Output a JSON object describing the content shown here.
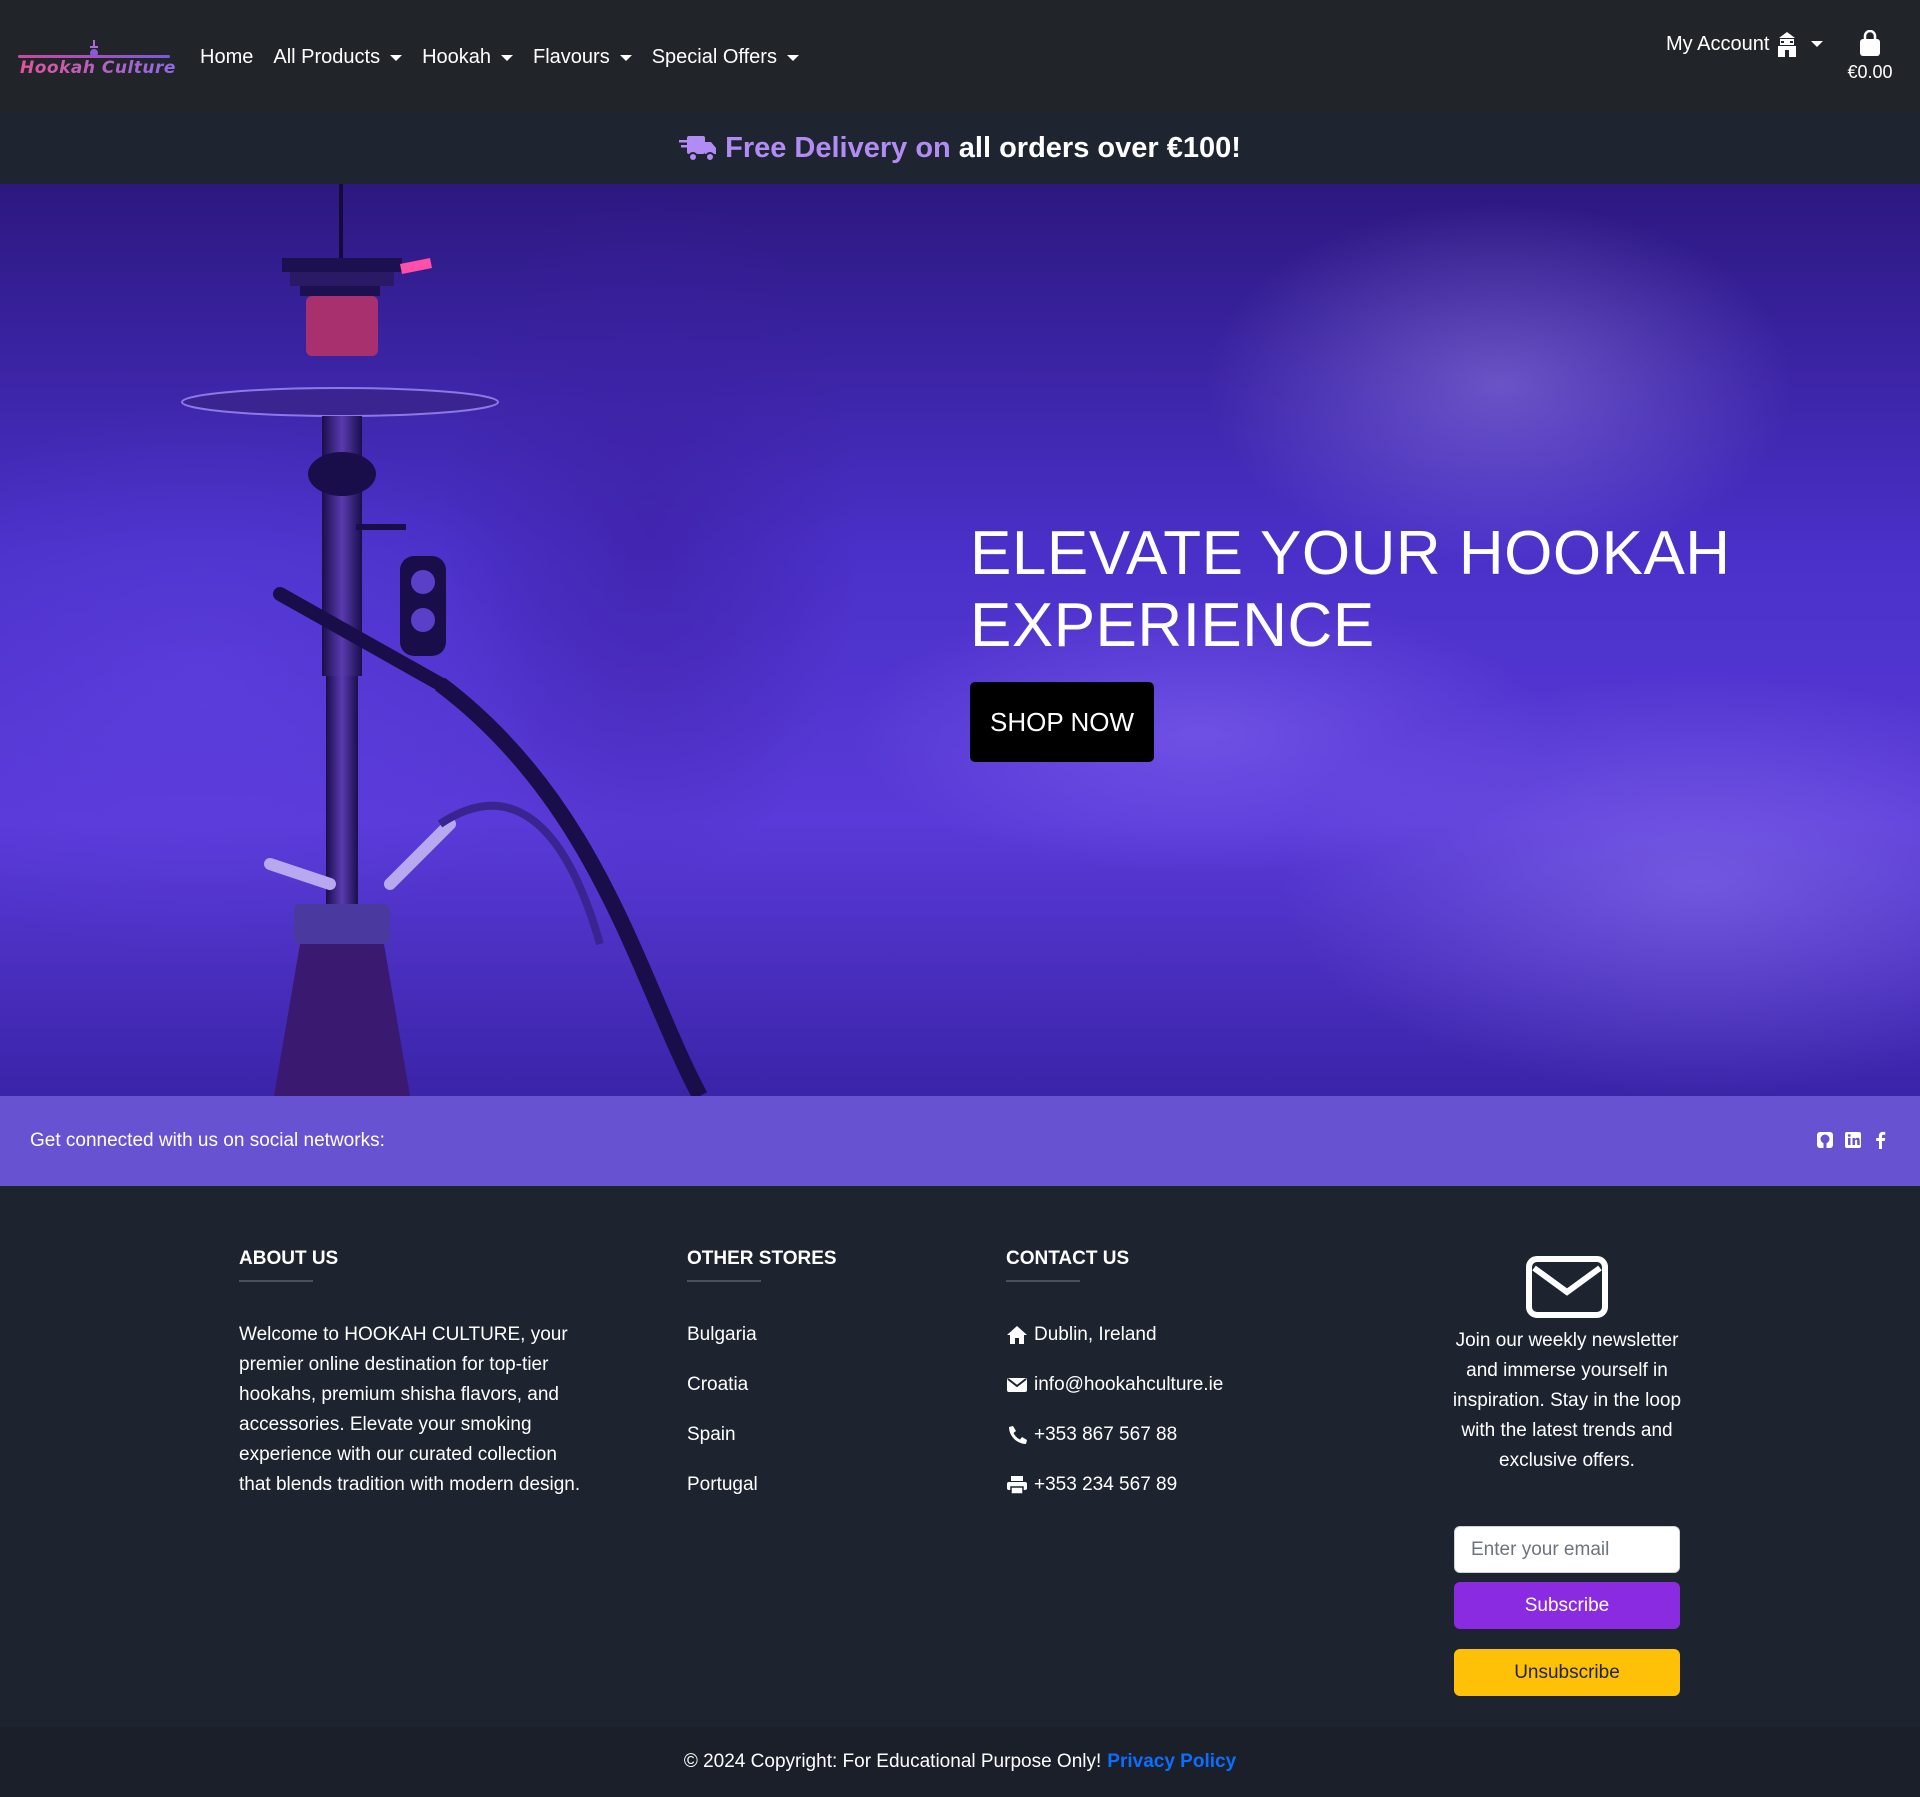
{
  "brand": {
    "logo_text": "Hookah Culture"
  },
  "nav": {
    "items": [
      {
        "label": "Home",
        "has_caret": false
      },
      {
        "label": "All Products",
        "has_caret": true
      },
      {
        "label": "Hookah",
        "has_caret": true
      },
      {
        "label": "Flavours",
        "has_caret": true
      },
      {
        "label": "Special Offers",
        "has_caret": true
      }
    ],
    "account_label": "My Account",
    "bag_total": "€0.00"
  },
  "banner": {
    "accent": "Free Delivery on",
    "rest": "all orders over €100!"
  },
  "hero": {
    "title_line1": "ELEVATE YOUR HOOKAH",
    "title_line2": "EXPERIENCE",
    "button": "SHOP NOW"
  },
  "social": {
    "text": "Get connected with us on social networks:",
    "icons": [
      "github-icon",
      "linkedin-icon",
      "facebook-icon"
    ]
  },
  "footer": {
    "about": {
      "title": "ABOUT US",
      "text": "Welcome to HOOKAH CULTURE, your premier online destination for top-tier hookahs, premium shisha flavors, and accessories. Elevate your smoking experience with our curated collection that blends tradition with modern design."
    },
    "stores": {
      "title": "OTHER STORES",
      "items": [
        "Bulgaria",
        "Croatia",
        "Spain",
        "Portugal"
      ]
    },
    "contact": {
      "title": "CONTACT US",
      "address": "Dublin, Ireland",
      "email": "info@hookahculture.ie",
      "phone": "+353 867 567 88",
      "fax": "+353 234 567 89"
    },
    "newsletter": {
      "text": "Join our weekly newsletter and immerse yourself in inspiration. Stay in the loop with the latest trends and exclusive offers.",
      "placeholder": "Enter your email",
      "subscribe": "Subscribe",
      "unsubscribe": "Unsubscribe"
    }
  },
  "copyright": {
    "text": "© 2024 Copyright: For Educational Purpose Only!",
    "link": "Privacy Policy"
  },
  "colors": {
    "accent": "#b28cf5",
    "social_bar": "#6752d1",
    "subscribe": "#8a2be2",
    "unsubscribe": "#ffc107",
    "link": "#0d6efd"
  }
}
